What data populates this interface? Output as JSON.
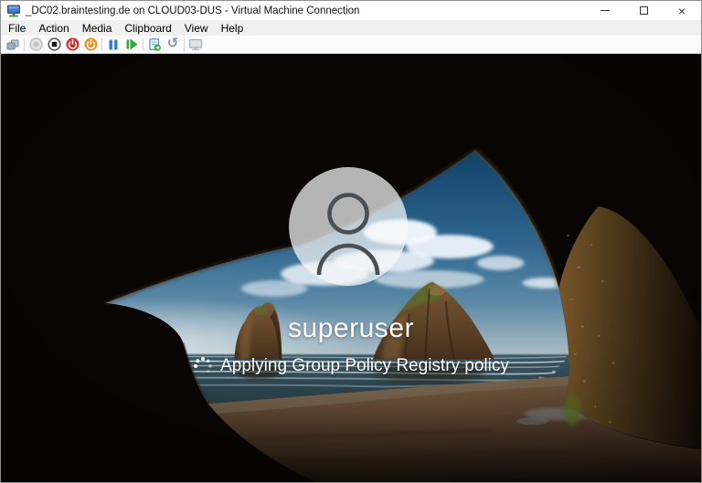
{
  "window": {
    "title": "_DC02.braintesting.de on CLOUD03-DUS - Virtual Machine Connection",
    "app_icon": "virtual-machine-connection-icon",
    "controls": {
      "minimize": "minimize",
      "maximize": "maximize",
      "close": "×"
    }
  },
  "menu": {
    "items": [
      "File",
      "Action",
      "Media",
      "Clipboard",
      "View",
      "Help"
    ]
  },
  "toolbar": {
    "icons": [
      "ctrl-alt-del-icon",
      "start-icon",
      "turn-off-icon",
      "shut-down-icon",
      "save-icon",
      "pause-icon",
      "resume-icon",
      "checkpoint-icon",
      "revert-icon",
      "enhanced-session-icon"
    ]
  },
  "vm": {
    "username": "superuser",
    "status_message": "Applying Group Policy Registry policy",
    "avatar": "user-silhouette-icon",
    "wallpaper": "beach-cave-scene"
  },
  "theme": {
    "pause_blue": "#2b7fd6",
    "resume_green": "#35a93a",
    "shutdown_red": "#d02f2f",
    "save_orange": "#e79324",
    "checkpoint_teal": "#3b9fc6",
    "revert_slate": "#7f99b0",
    "monitor_screen_blue": "#3d7edb",
    "monitor_base_green": "#3fa33f",
    "status_text": "#ffffff"
  }
}
